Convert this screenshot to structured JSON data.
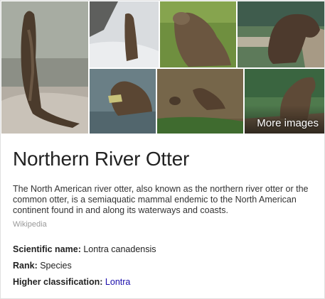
{
  "images": {
    "tiles": [
      {
        "alt": "otter standing on rock"
      },
      {
        "alt": "otter standing in snow"
      },
      {
        "alt": "otter on grass"
      },
      {
        "alt": "otter resting on dock"
      },
      {
        "alt": "otter eating fish"
      },
      {
        "alt": "otters swimming"
      },
      {
        "alt": "otter on log"
      }
    ],
    "more_label": "More images"
  },
  "title": "Northern River Otter",
  "description": "The North American river otter, also known as the northern river otter or the common otter, is a semiaquatic mammal endemic to the North American continent found in and along its waterways and coasts.",
  "source": "Wikipedia",
  "facts": [
    {
      "key": "Scientific name:",
      "value": "Lontra canadensis"
    },
    {
      "key": "Rank:",
      "value": "Species"
    },
    {
      "key": "Higher classification:",
      "value": "Lontra"
    }
  ]
}
